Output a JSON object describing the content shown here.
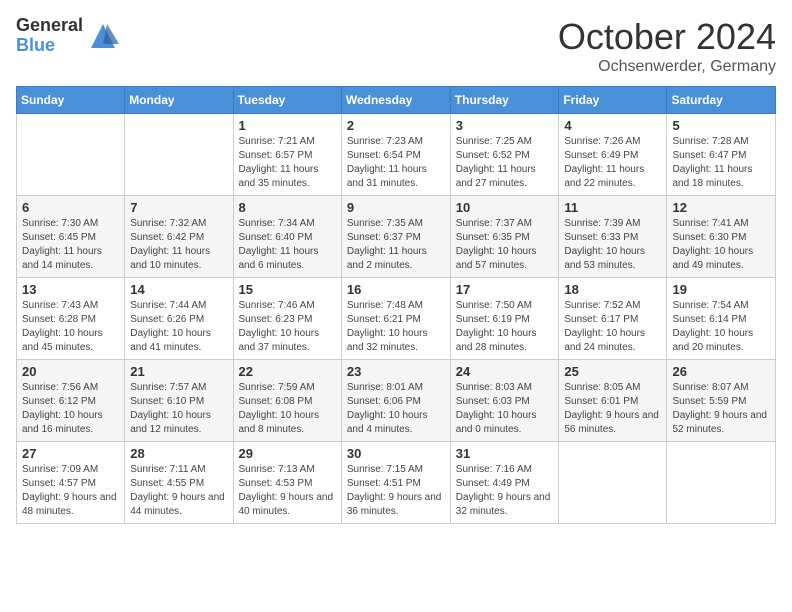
{
  "logo": {
    "general": "General",
    "blue": "Blue"
  },
  "header": {
    "month": "October 2024",
    "location": "Ochsenwerder, Germany"
  },
  "days_of_week": [
    "Sunday",
    "Monday",
    "Tuesday",
    "Wednesday",
    "Thursday",
    "Friday",
    "Saturday"
  ],
  "weeks": [
    [
      {
        "day": "",
        "info": ""
      },
      {
        "day": "",
        "info": ""
      },
      {
        "day": "1",
        "info": "Sunrise: 7:21 AM\nSunset: 6:57 PM\nDaylight: 11 hours and 35 minutes."
      },
      {
        "day": "2",
        "info": "Sunrise: 7:23 AM\nSunset: 6:54 PM\nDaylight: 11 hours and 31 minutes."
      },
      {
        "day": "3",
        "info": "Sunrise: 7:25 AM\nSunset: 6:52 PM\nDaylight: 11 hours and 27 minutes."
      },
      {
        "day": "4",
        "info": "Sunrise: 7:26 AM\nSunset: 6:49 PM\nDaylight: 11 hours and 22 minutes."
      },
      {
        "day": "5",
        "info": "Sunrise: 7:28 AM\nSunset: 6:47 PM\nDaylight: 11 hours and 18 minutes."
      }
    ],
    [
      {
        "day": "6",
        "info": "Sunrise: 7:30 AM\nSunset: 6:45 PM\nDaylight: 11 hours and 14 minutes."
      },
      {
        "day": "7",
        "info": "Sunrise: 7:32 AM\nSunset: 6:42 PM\nDaylight: 11 hours and 10 minutes."
      },
      {
        "day": "8",
        "info": "Sunrise: 7:34 AM\nSunset: 6:40 PM\nDaylight: 11 hours and 6 minutes."
      },
      {
        "day": "9",
        "info": "Sunrise: 7:35 AM\nSunset: 6:37 PM\nDaylight: 11 hours and 2 minutes."
      },
      {
        "day": "10",
        "info": "Sunrise: 7:37 AM\nSunset: 6:35 PM\nDaylight: 10 hours and 57 minutes."
      },
      {
        "day": "11",
        "info": "Sunrise: 7:39 AM\nSunset: 6:33 PM\nDaylight: 10 hours and 53 minutes."
      },
      {
        "day": "12",
        "info": "Sunrise: 7:41 AM\nSunset: 6:30 PM\nDaylight: 10 hours and 49 minutes."
      }
    ],
    [
      {
        "day": "13",
        "info": "Sunrise: 7:43 AM\nSunset: 6:28 PM\nDaylight: 10 hours and 45 minutes."
      },
      {
        "day": "14",
        "info": "Sunrise: 7:44 AM\nSunset: 6:26 PM\nDaylight: 10 hours and 41 minutes."
      },
      {
        "day": "15",
        "info": "Sunrise: 7:46 AM\nSunset: 6:23 PM\nDaylight: 10 hours and 37 minutes."
      },
      {
        "day": "16",
        "info": "Sunrise: 7:48 AM\nSunset: 6:21 PM\nDaylight: 10 hours and 32 minutes."
      },
      {
        "day": "17",
        "info": "Sunrise: 7:50 AM\nSunset: 6:19 PM\nDaylight: 10 hours and 28 minutes."
      },
      {
        "day": "18",
        "info": "Sunrise: 7:52 AM\nSunset: 6:17 PM\nDaylight: 10 hours and 24 minutes."
      },
      {
        "day": "19",
        "info": "Sunrise: 7:54 AM\nSunset: 6:14 PM\nDaylight: 10 hours and 20 minutes."
      }
    ],
    [
      {
        "day": "20",
        "info": "Sunrise: 7:56 AM\nSunset: 6:12 PM\nDaylight: 10 hours and 16 minutes."
      },
      {
        "day": "21",
        "info": "Sunrise: 7:57 AM\nSunset: 6:10 PM\nDaylight: 10 hours and 12 minutes."
      },
      {
        "day": "22",
        "info": "Sunrise: 7:59 AM\nSunset: 6:08 PM\nDaylight: 10 hours and 8 minutes."
      },
      {
        "day": "23",
        "info": "Sunrise: 8:01 AM\nSunset: 6:06 PM\nDaylight: 10 hours and 4 minutes."
      },
      {
        "day": "24",
        "info": "Sunrise: 8:03 AM\nSunset: 6:03 PM\nDaylight: 10 hours and 0 minutes."
      },
      {
        "day": "25",
        "info": "Sunrise: 8:05 AM\nSunset: 6:01 PM\nDaylight: 9 hours and 56 minutes."
      },
      {
        "day": "26",
        "info": "Sunrise: 8:07 AM\nSunset: 5:59 PM\nDaylight: 9 hours and 52 minutes."
      }
    ],
    [
      {
        "day": "27",
        "info": "Sunrise: 7:09 AM\nSunset: 4:57 PM\nDaylight: 9 hours and 48 minutes."
      },
      {
        "day": "28",
        "info": "Sunrise: 7:11 AM\nSunset: 4:55 PM\nDaylight: 9 hours and 44 minutes."
      },
      {
        "day": "29",
        "info": "Sunrise: 7:13 AM\nSunset: 4:53 PM\nDaylight: 9 hours and 40 minutes."
      },
      {
        "day": "30",
        "info": "Sunrise: 7:15 AM\nSunset: 4:51 PM\nDaylight: 9 hours and 36 minutes."
      },
      {
        "day": "31",
        "info": "Sunrise: 7:16 AM\nSunset: 4:49 PM\nDaylight: 9 hours and 32 minutes."
      },
      {
        "day": "",
        "info": ""
      },
      {
        "day": "",
        "info": ""
      }
    ]
  ]
}
